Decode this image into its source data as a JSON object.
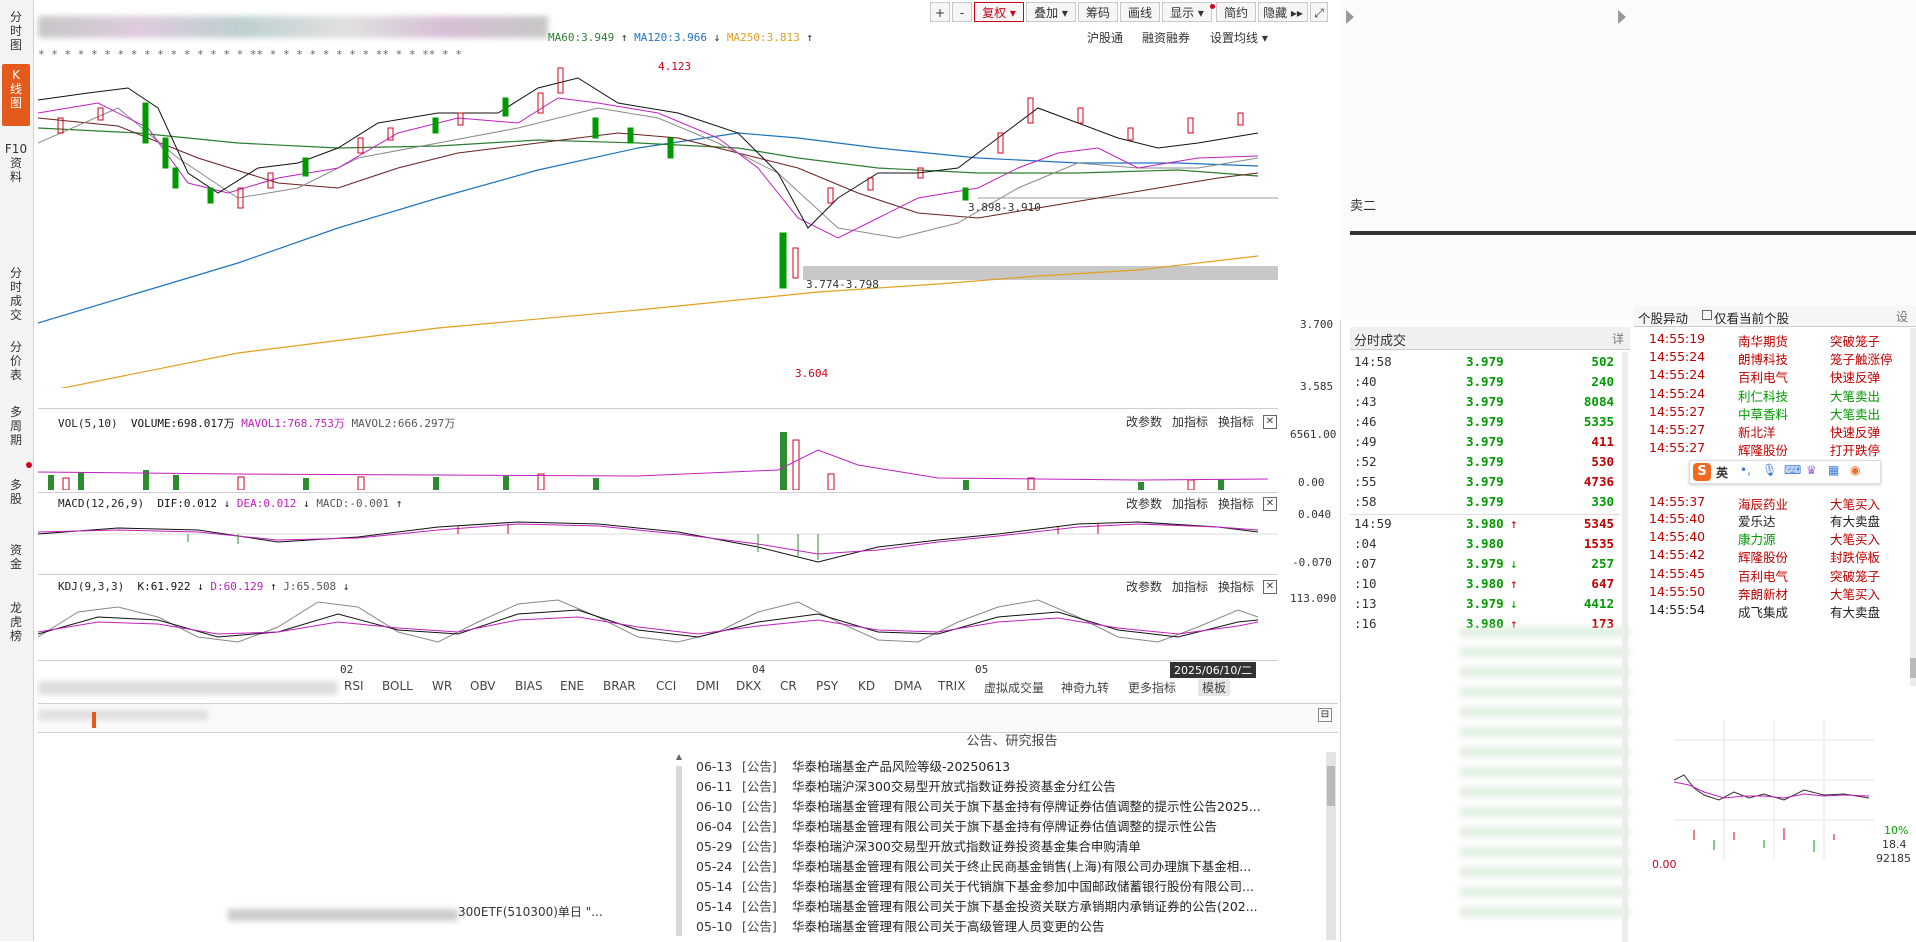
{
  "leftnav": {
    "items": [
      {
        "label": "分\n时\n图"
      },
      {
        "label": "K\n线\n图"
      },
      {
        "label": "F10\n资\n料"
      },
      {
        "label": "分\n时\n成\n交"
      },
      {
        "label": "分\n价\n表"
      },
      {
        "label": "多\n周\n期"
      },
      {
        "label": "多\n股"
      },
      {
        "label": "资\n金"
      },
      {
        "label": "龙\n虎\n榜"
      }
    ]
  },
  "toolbar": {
    "plus": "+",
    "minus": "-",
    "fuquan": "复权 ▾",
    "diejia": "叠加 ▾",
    "chouma": "筹码",
    "huaxian": "画线",
    "xianshi": "显示 ▾",
    "jianyue": "简约",
    "yincang": "隐藏 ▸▸",
    "expand": "⤢"
  },
  "kline": {
    "ma_labels": [
      "MA60:3.949",
      "MA120:3.966",
      "MA250:3.813"
    ],
    "ma_colors": [
      "#2e7d32",
      "#1e73be",
      "#e0a020"
    ],
    "right_links": [
      "沪股通",
      "融资融券",
      "设置均线 ▾"
    ],
    "price_axis": [
      "3.700",
      "3.585"
    ],
    "annotations": {
      "high": "4.123",
      "low": "3.604",
      "range1": "3.774-3.798",
      "range2": "3.898-3.910"
    }
  },
  "vol": {
    "title": "VOL(5,10)",
    "volume": "VOLUME:698.017万",
    "mavol1": "MAVOL1:768.753万",
    "mavol2": "MAVOL2:666.297万",
    "axis_top": "6561.00",
    "axis_bottom": "0.00"
  },
  "macd": {
    "title": "MACD(12,26,9)",
    "dif": "DIF:0.012",
    "dea": "DEA:0.012",
    "macd": "MACD:-0.001",
    "axis_top": "0.040",
    "axis_bottom": "-0.070"
  },
  "kdj": {
    "title": "KDJ(9,3,3)",
    "k": "K:61.922",
    "d": "D:60.129",
    "j": "J:65.508",
    "axis_top": "113.090"
  },
  "panel_ctrls": {
    "gaicanshu": "改参数",
    "jiazhibiao": "加指标",
    "huanzhibiao": "换指标",
    "close": "✕"
  },
  "xaxis": {
    "labels": [
      "02",
      "04",
      "05",
      "2025/06/10/二"
    ]
  },
  "indicator_tabs": [
    "RSI",
    "BOLL",
    "WR",
    "OBV",
    "BIAS",
    "ENE",
    "BRAR",
    "CCI",
    "DMI",
    "DKX",
    "CR",
    "PSY",
    "KD",
    "DMA",
    "TRIX",
    "虚拟成交量",
    "神奇九转",
    "更多指标",
    "模板"
  ],
  "announcements": {
    "title": "公告、研究报告",
    "items": [
      {
        "date": "06-13",
        "type": "[公告]",
        "text": "华泰柏瑞基金产品风险等级-20250613"
      },
      {
        "date": "06-11",
        "type": "[公告]",
        "text": "华泰柏瑞沪深300交易型开放式指数证券投资基金分红公告"
      },
      {
        "date": "06-10",
        "type": "[公告]",
        "text": "华泰柏瑞基金管理有限公司关于旗下基金持有停牌证券估值调整的提示性公告2025..."
      },
      {
        "date": "06-04",
        "type": "[公告]",
        "text": "华泰柏瑞基金管理有限公司关于旗下基金持有停牌证券估值调整的提示性公告"
      },
      {
        "date": "05-29",
        "type": "[公告]",
        "text": "华泰柏瑞沪深300交易型开放式指数证券投资基金集合申购清单"
      },
      {
        "date": "05-24",
        "type": "[公告]",
        "text": "华泰柏瑞基金管理有限公司关于终止民商基金销售(上海)有限公司办理旗下基金相..."
      },
      {
        "date": "05-14",
        "type": "[公告]",
        "text": "华泰柏瑞基金管理有限公司关于代销旗下基金参加中国邮政储蓄银行股份有限公司..."
      },
      {
        "date": "05-14",
        "type": "[公告]",
        "text": "华泰柏瑞基金管理有限公司关于旗下基金投资关联方承销期内承销证券的公告(202..."
      },
      {
        "date": "05-10",
        "type": "[公告]",
        "text": "华泰柏瑞基金管理有限公司关于高级管理人员变更的公告"
      }
    ],
    "left_snippet": "300ETF(510300)单日 \"..."
  },
  "trades": {
    "title": "分时成交",
    "detail": "详",
    "rows": [
      {
        "time": "14:58",
        "price": "3.979",
        "arrow": "",
        "vol": "502",
        "volcolor": "green"
      },
      {
        "time": ":40",
        "price": "3.979",
        "arrow": "",
        "vol": "240",
        "volcolor": "green"
      },
      {
        "time": ":43",
        "price": "3.979",
        "arrow": "",
        "vol": "8084",
        "volcolor": "green"
      },
      {
        "time": ":46",
        "price": "3.979",
        "arrow": "",
        "vol": "5335",
        "volcolor": "green"
      },
      {
        "time": ":49",
        "price": "3.979",
        "arrow": "",
        "vol": "411",
        "volcolor": "red"
      },
      {
        "time": ":52",
        "price": "3.979",
        "arrow": "",
        "vol": "530",
        "volcolor": "red"
      },
      {
        "time": ":55",
        "price": "3.979",
        "arrow": "",
        "vol": "4736",
        "volcolor": "red"
      },
      {
        "time": ":58",
        "price": "3.979",
        "arrow": "",
        "vol": "330",
        "volcolor": "green"
      },
      {
        "time": "14:59",
        "price": "3.980",
        "arrow": "↑",
        "vol": "5345",
        "volcolor": "red"
      },
      {
        "time": ":04",
        "price": "3.980",
        "arrow": "",
        "vol": "1535",
        "volcolor": "red"
      },
      {
        "time": ":07",
        "price": "3.979",
        "arrow": "↓",
        "vol": "257",
        "volcolor": "green"
      },
      {
        "time": ":10",
        "price": "3.980",
        "arrow": "↑",
        "vol": "647",
        "volcolor": "red"
      },
      {
        "time": ":13",
        "price": "3.979",
        "arrow": "↓",
        "vol": "4412",
        "volcolor": "green"
      },
      {
        "time": ":16",
        "price": "3.980",
        "arrow": "↑",
        "vol": "173",
        "volcolor": "red"
      }
    ],
    "sell_label": "卖二"
  },
  "movement": {
    "tab1": "个股异动",
    "tab2": "仅看当前个股",
    "settings": "设",
    "rows": [
      {
        "time": "14:55:19",
        "stock": "南华期货",
        "event": "突破笼子"
      },
      {
        "time": "14:55:24",
        "stock": "朗博科技",
        "event": "笼子触涨停"
      },
      {
        "time": "14:55:24",
        "stock": "百利电气",
        "event": "快速反弹"
      },
      {
        "time": "14:55:24",
        "stock": "利仁科技",
        "event": "大笔卖出"
      },
      {
        "time": "14:55:27",
        "stock": "中草香料",
        "event": "大笔卖出"
      },
      {
        "time": "14:55:27",
        "stock": "新北洋",
        "event": "快速反弹"
      },
      {
        "time": "14:55:27",
        "stock": "辉隆股份",
        "event": "打开跌停"
      },
      {
        "time": "14:55:37",
        "stock": "海辰药业",
        "event": "大笔买入"
      },
      {
        "time": "14:55:40",
        "stock": "爱乐达",
        "event": "有大卖盘"
      },
      {
        "time": "14:55:40",
        "stock": "康力源",
        "event": "大笔买入"
      },
      {
        "time": "14:55:42",
        "stock": "辉隆股份",
        "event": "封跌停板"
      },
      {
        "time": "14:55:45",
        "stock": "百利电气",
        "event": "突破笼子"
      },
      {
        "time": "14:55:50",
        "stock": "奔朗新材",
        "event": "大笔买入"
      },
      {
        "time": "14:55:54",
        "stock": "成飞集成",
        "event": "有大卖盘"
      }
    ],
    "ime": "英"
  },
  "mini": {
    "pct": "10%",
    "v1": "18.4",
    "v2": "92185",
    "v3": "0.00"
  }
}
